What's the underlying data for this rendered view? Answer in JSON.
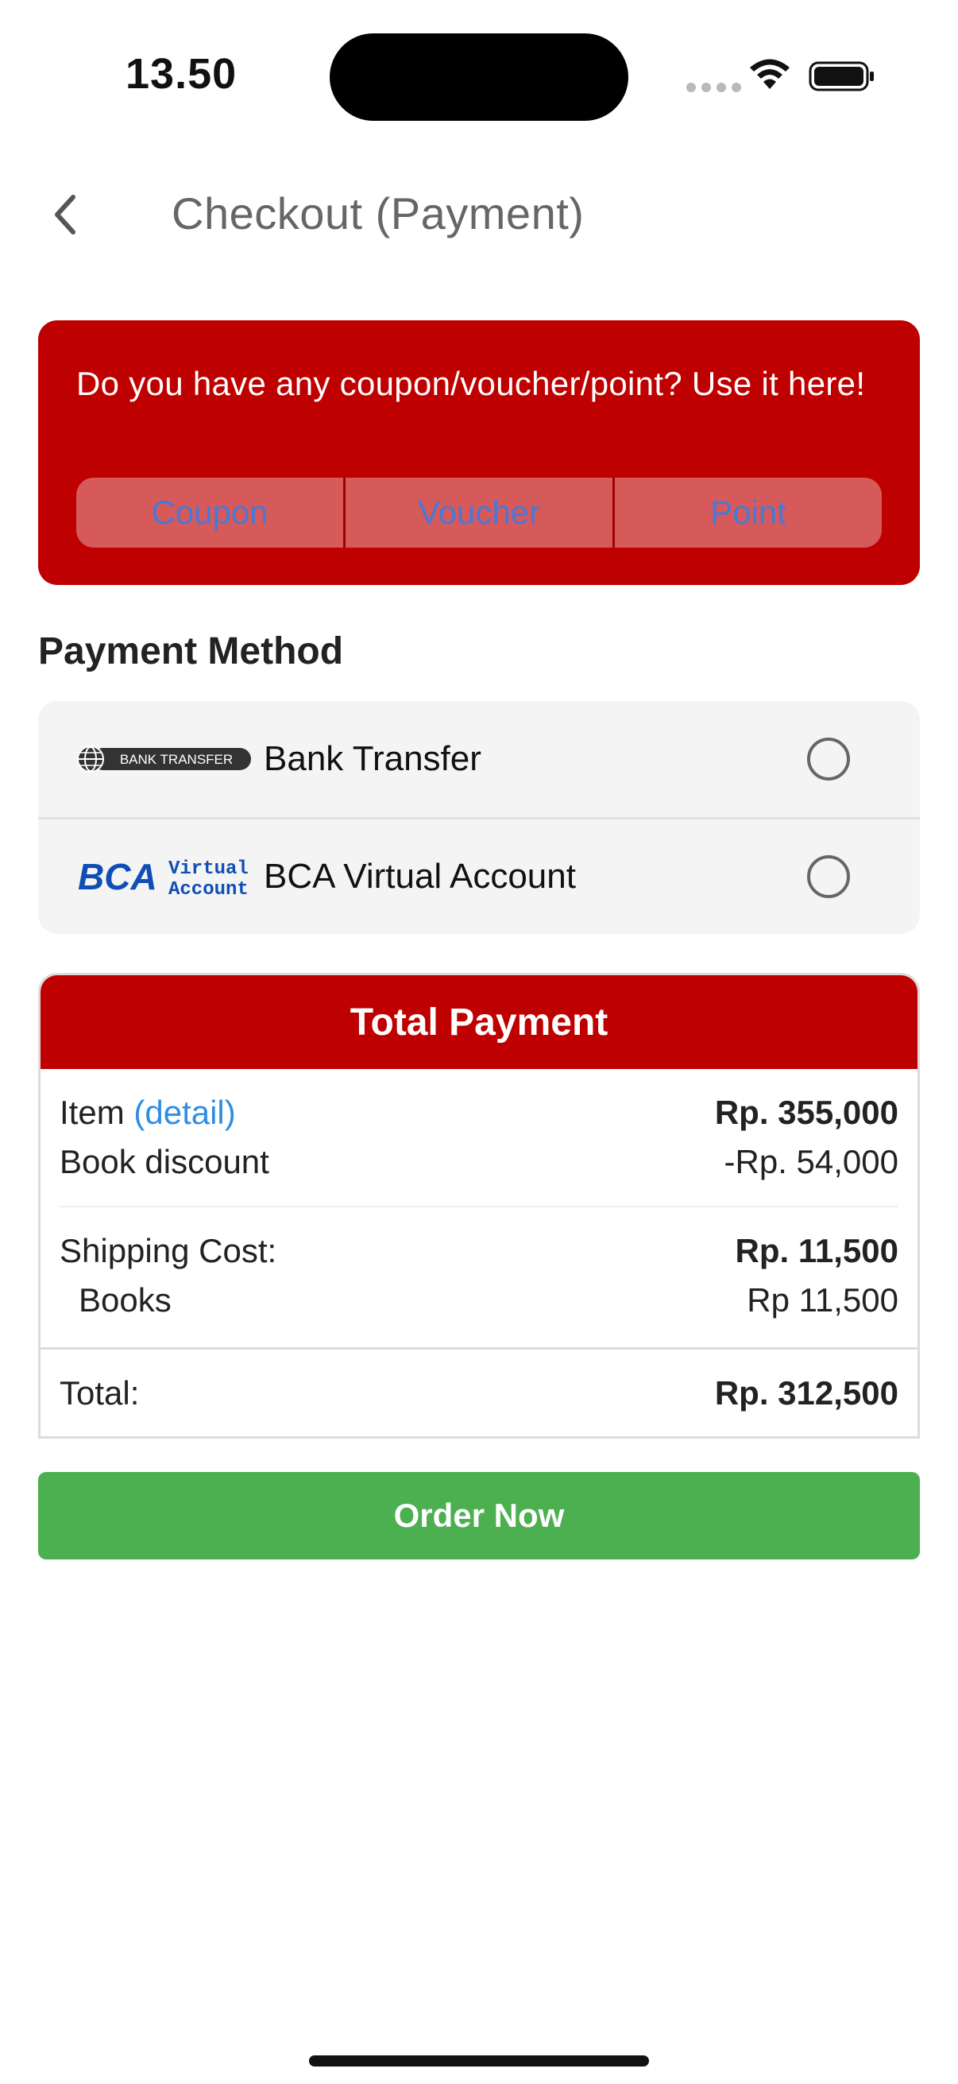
{
  "status_bar": {
    "time": "13.50"
  },
  "header": {
    "title": "Checkout (Payment)"
  },
  "coupon": {
    "prompt": "Do you have any coupon/voucher/point? Use it here!",
    "tabs": [
      "Coupon",
      "Voucher",
      "Point"
    ]
  },
  "payment_method": {
    "title": "Payment Method",
    "options": [
      {
        "logo_text": "BANK TRANSFER",
        "label": "Bank Transfer",
        "selected": false
      },
      {
        "logo_text_1": "BCA",
        "logo_text_2": "Virtual",
        "logo_text_3": "Account",
        "label": "BCA Virtual Account",
        "selected": false
      }
    ]
  },
  "total_payment": {
    "title": "Total Payment",
    "item_label": "Item",
    "detail_link": "(detail)",
    "item_value": "Rp. 355,000",
    "discount_label": "Book discount",
    "discount_value": "-Rp. 54,000",
    "shipping_label": "Shipping Cost:",
    "shipping_value": "Rp. 11,500",
    "shipping_books_label": "Books",
    "shipping_books_value": "Rp 11,500",
    "total_label": "Total:",
    "total_value": "Rp. 312,500"
  },
  "order_button": {
    "label": "Order Now"
  },
  "colors": {
    "primary_red": "#bf0000",
    "order_green": "#4caf50",
    "link_blue": "#2f8de4"
  }
}
